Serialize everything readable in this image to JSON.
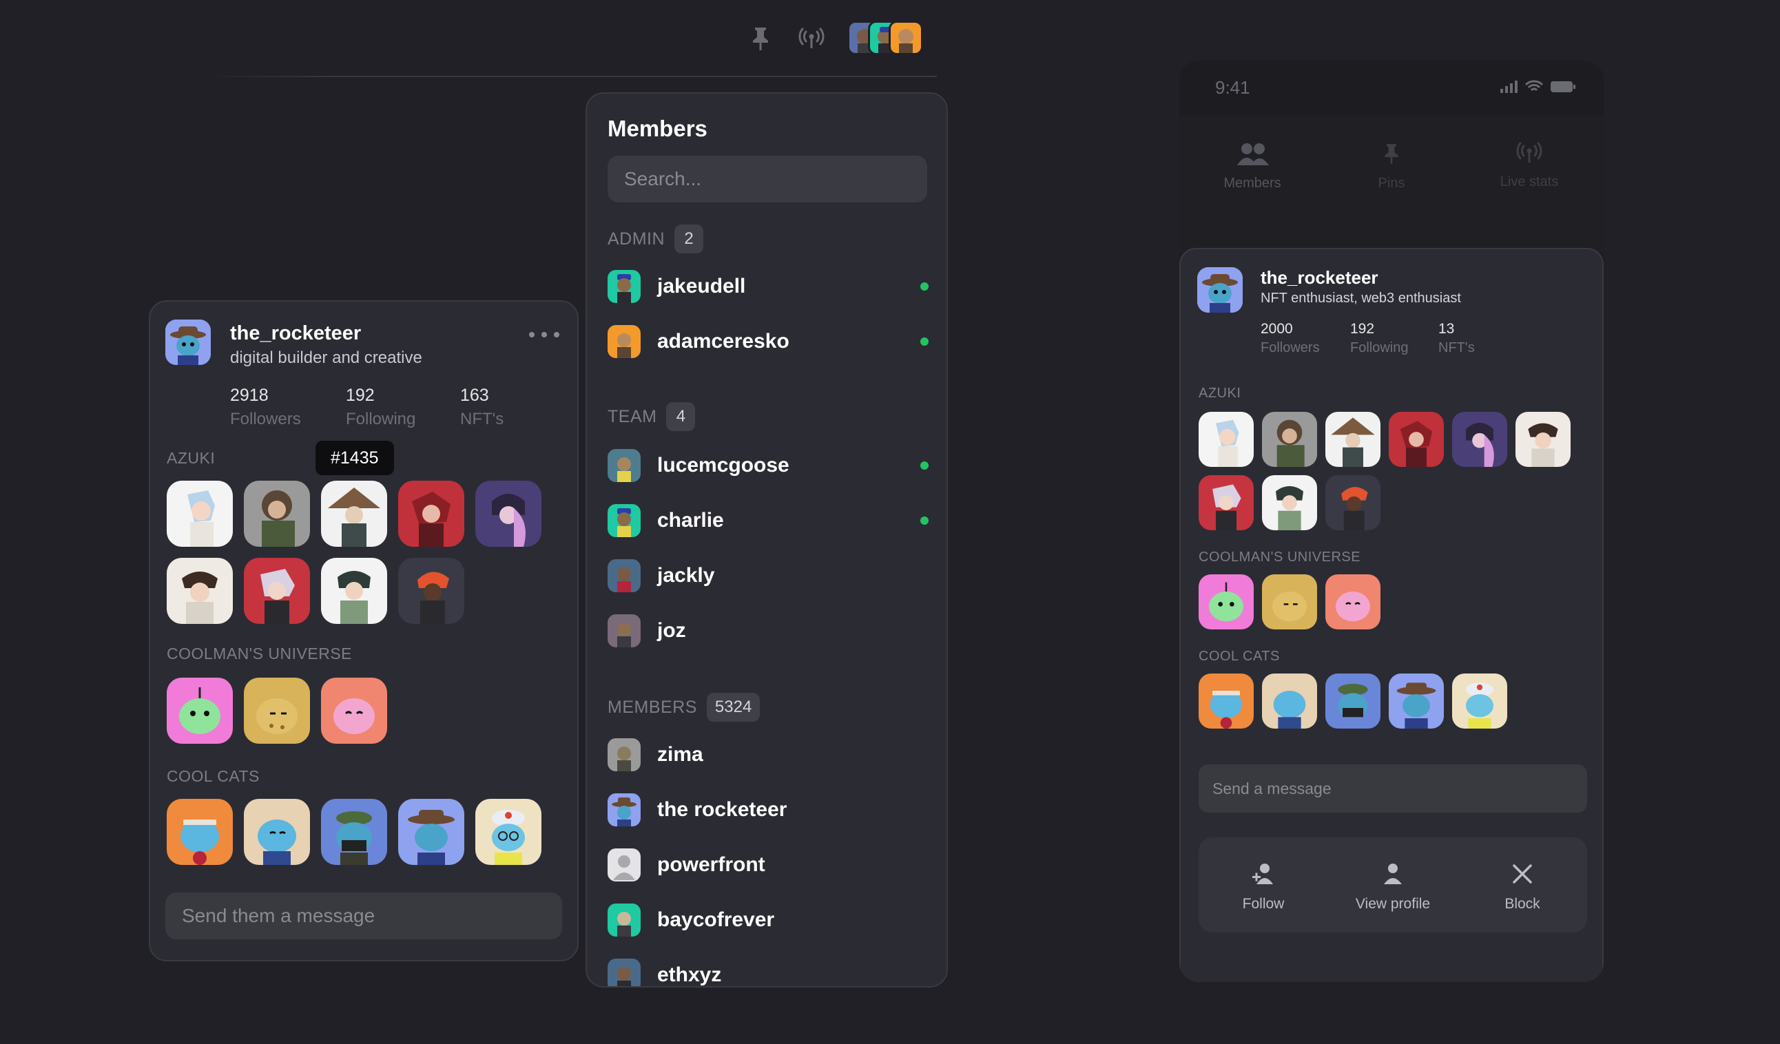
{
  "toolbar": {
    "pin_icon": "pin-icon",
    "live_icon": "broadcast-icon"
  },
  "profile_card": {
    "username": "the_rocketeer",
    "bio": "digital builder and creative",
    "stats": [
      {
        "value": "2918",
        "label": "Followers"
      },
      {
        "value": "192",
        "label": "Following"
      },
      {
        "value": "163",
        "label": "NFT's"
      }
    ],
    "tooltip": "#1435",
    "sections": [
      {
        "title": "AZUKI",
        "count": 9
      },
      {
        "title": "COOLMAN'S UNIVERSE",
        "count": 3
      },
      {
        "title": "COOL CATS",
        "count": 5
      }
    ],
    "message_placeholder": "Send them a message"
  },
  "members_panel": {
    "title": "Members",
    "search_placeholder": "Search...",
    "groups": [
      {
        "label": "ADMIN",
        "count": "2",
        "members": [
          {
            "name": "jakeudell",
            "online": true
          },
          {
            "name": "adamceresko",
            "online": true
          }
        ]
      },
      {
        "label": "TEAM",
        "count": "4",
        "members": [
          {
            "name": "lucemcgoose",
            "online": true
          },
          {
            "name": "charlie",
            "online": true
          },
          {
            "name": "jackly",
            "online": false
          },
          {
            "name": "joz",
            "online": false
          }
        ]
      },
      {
        "label": "MEMBERS",
        "count": "5324",
        "members": [
          {
            "name": "zima",
            "online": false
          },
          {
            "name": "the rocketeer",
            "online": false
          },
          {
            "name": "powerfront",
            "online": false
          },
          {
            "name": "baycofrever",
            "online": false
          },
          {
            "name": "ethxyz",
            "online": false
          }
        ]
      }
    ],
    "online_color": "#22c55e"
  },
  "phone": {
    "time": "9:41",
    "tabs": [
      {
        "label": "Members",
        "icon": "members-icon"
      },
      {
        "label": "Pins",
        "icon": "pin-icon"
      },
      {
        "label": "Live stats",
        "icon": "broadcast-icon"
      }
    ],
    "sheet": {
      "username": "the_rocketeer",
      "bio": "NFT enthusiast, web3 enthusiast",
      "stats": [
        {
          "value": "2000",
          "label": "Followers"
        },
        {
          "value": "192",
          "label": "Following"
        },
        {
          "value": "13",
          "label": "NFT's"
        }
      ],
      "sections": [
        {
          "title": "AZUKI"
        },
        {
          "title": "COOLMAN'S UNIVERSE"
        },
        {
          "title": "COOL CATS"
        }
      ],
      "message_placeholder": "Send a message",
      "actions": [
        {
          "label": "Follow",
          "icon": "add-user-icon"
        },
        {
          "label": "View profile",
          "icon": "user-icon"
        },
        {
          "label": "Block",
          "icon": "close-icon"
        }
      ]
    }
  }
}
